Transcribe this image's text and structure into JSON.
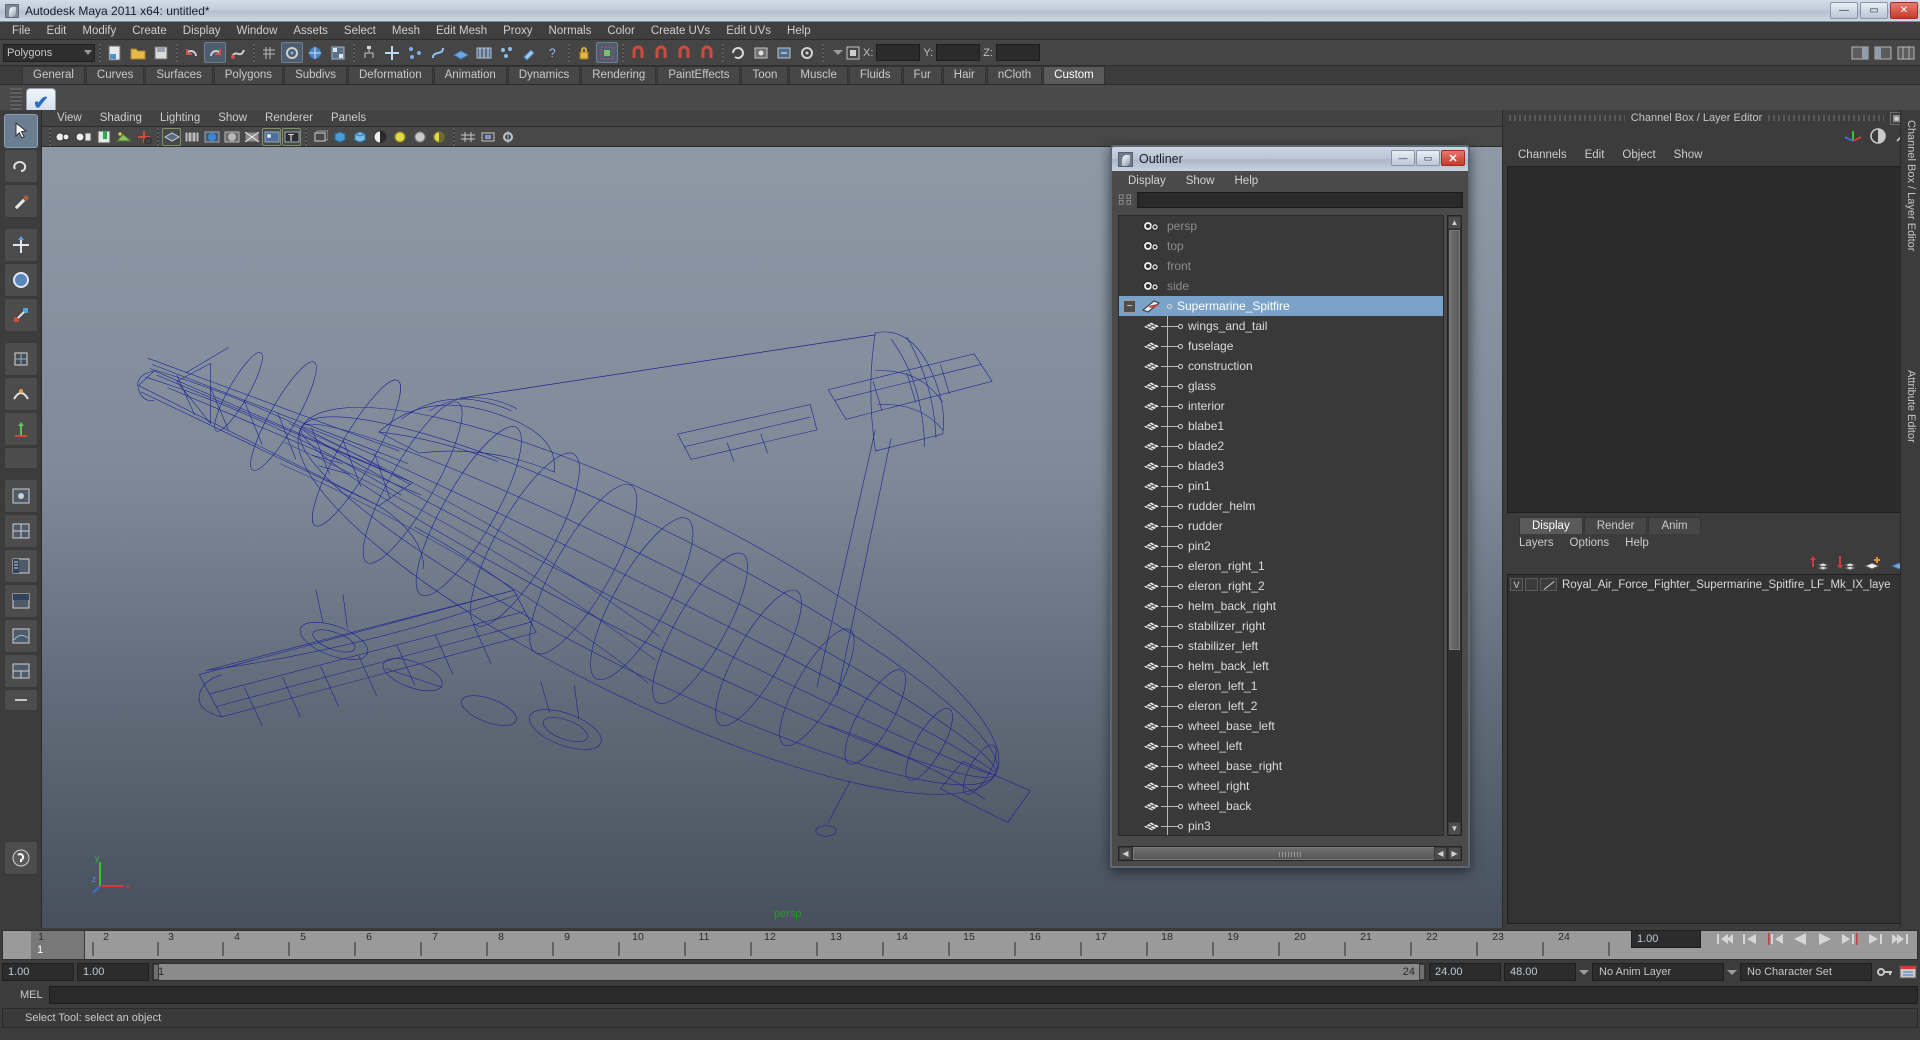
{
  "window": {
    "title": "Autodesk Maya 2011 x64: untitled*",
    "minimize": "—",
    "maximize": "▭",
    "close": "✕"
  },
  "menubar": {
    "items": [
      "File",
      "Edit",
      "Modify",
      "Create",
      "Display",
      "Window",
      "Assets",
      "Select",
      "Mesh",
      "Edit Mesh",
      "Proxy",
      "Normals",
      "Color",
      "Create UVs",
      "Edit UVs",
      "Help"
    ]
  },
  "statusline": {
    "mode_selector": "Polygons",
    "coord_labels": {
      "x": "X:",
      "y": "Y:",
      "z": "Z:"
    },
    "coord_values": {
      "x": "",
      "y": "",
      "z": ""
    }
  },
  "shelf": {
    "tabs": [
      "General",
      "Curves",
      "Surfaces",
      "Polygons",
      "Subdivs",
      "Deformation",
      "Animation",
      "Dynamics",
      "Rendering",
      "PaintEffects",
      "Toon",
      "Muscle",
      "Fluids",
      "Fur",
      "Hair",
      "nCloth",
      "Custom"
    ],
    "active_tab": "Custom",
    "items": [
      {
        "icon": "blue-check-icon"
      }
    ]
  },
  "viewport": {
    "menus": [
      "View",
      "Shading",
      "Lighting",
      "Show",
      "Renderer",
      "Panels"
    ],
    "camera_label": "persp",
    "axis": {
      "x": "x",
      "y": "y",
      "z": "z"
    }
  },
  "outliner": {
    "title": "Outliner",
    "win_buttons": {
      "minimize": "—",
      "maximize": "▭",
      "close": "✕"
    },
    "menus": [
      "Display",
      "Show",
      "Help"
    ],
    "search_value": "",
    "selected": "Supermarine_Spitfire",
    "cameras": [
      "persp",
      "top",
      "front",
      "side"
    ],
    "root": "Supermarine_Spitfire",
    "children": [
      "wings_and_tail",
      "fuselage",
      "construction",
      "glass",
      "interior",
      "blabe1",
      "blade2",
      "blade3",
      "pin1",
      "rudder_helm",
      "rudder",
      "pin2",
      "eleron_right_1",
      "eleron_right_2",
      "helm_back_right",
      "stabilizer_right",
      "stabilizer_left",
      "helm_back_left",
      "eleron_left_1",
      "eleron_left_2",
      "wheel_base_left",
      "wheel_left",
      "wheel_base_right",
      "wheel_right",
      "wheel_back",
      "pin3"
    ]
  },
  "channelbox": {
    "header_title": "Channel Box / Layer Editor",
    "header_buttons": {
      "float": "▣",
      "close": "✕"
    },
    "menus": [
      "Channels",
      "Edit",
      "Object",
      "Show"
    ],
    "side_tab": "Channel Box / Layer Editor",
    "attr_side_tab": "Attribute Editor"
  },
  "layer_editor": {
    "tabs": [
      "Display",
      "Render",
      "Anim"
    ],
    "active_tab": "Display",
    "menus": [
      "Layers",
      "Options",
      "Help"
    ],
    "layers": [
      {
        "visibility": "V",
        "type": "",
        "name": "Royal_Air_Force_Fighter_Supermarine_Spitfire_LF_Mk_IX_laye"
      }
    ]
  },
  "timeline": {
    "ticks": [
      "1",
      "2",
      "3",
      "4",
      "5",
      "6",
      "7",
      "8",
      "9",
      "10",
      "11",
      "12",
      "13",
      "14",
      "15",
      "16",
      "17",
      "18",
      "19",
      "20",
      "21",
      "22",
      "23",
      "24"
    ],
    "current_frame": "1",
    "range_start_field": "1.00",
    "range_start2_field": "1.00",
    "range_bar_left": "1",
    "range_bar_right": "24",
    "range_end_field": "24.00",
    "range_end2_field": "48.00",
    "playback_speed": "1.00",
    "anim_layer": "No Anim Layer",
    "character_set": "No Character Set",
    "playback_buttons": [
      "go-to-start",
      "step-back-key",
      "step-back-frame",
      "play-backwards",
      "play-forwards",
      "step-forward-frame",
      "step-forward-key",
      "go-to-end"
    ]
  },
  "command_line": {
    "label": "MEL",
    "value": ""
  },
  "status_bar": {
    "message": "Select Tool: select an object"
  },
  "colors": {
    "accent_selection": "#7ba2c9",
    "wireframe": "#1a1a8c",
    "bg_dark": "#3c3c3c",
    "viewport_top": "#8e99a6",
    "viewport_bottom": "#47505c",
    "persp_green": "#1ea01e"
  }
}
